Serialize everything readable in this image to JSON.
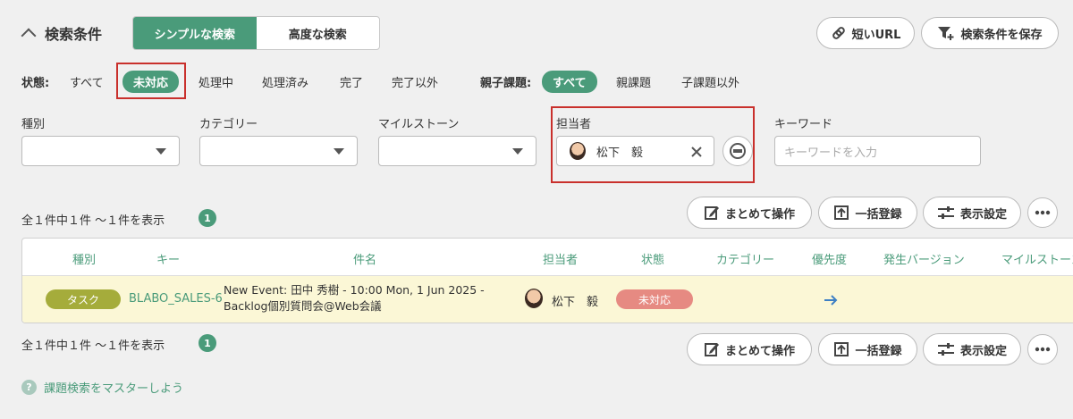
{
  "header": {
    "title": "検索条件",
    "tabs": [
      {
        "label": "シンプルな検索",
        "active": true
      },
      {
        "label": "高度な検索",
        "active": false
      }
    ],
    "short_url_label": "短いURL",
    "save_condition_label": "検索条件を保存"
  },
  "status_filter": {
    "label": "状態:",
    "options": [
      "すべて",
      "未対応",
      "処理中",
      "処理済み",
      "完了",
      "完了以外"
    ],
    "selected": "未対応"
  },
  "parent_filter": {
    "label": "親子課題:",
    "options": [
      "すべて",
      "親課題",
      "子課題以外"
    ],
    "selected": "すべて"
  },
  "fields": {
    "type_label": "種別",
    "category_label": "カテゴリー",
    "milestone_label": "マイルストーン",
    "assignee_label": "担当者",
    "assignee_value": "松下　毅",
    "keyword_label": "キーワード",
    "keyword_placeholder": "キーワードを入力"
  },
  "summary": {
    "count_text": "全１件中１件 〜１件を表示",
    "page_badge": "1"
  },
  "actions": {
    "bulk_label": "まとめて操作",
    "bulk_register_label": "一括登録",
    "display_settings_label": "表示設定"
  },
  "table": {
    "headers": [
      "種別",
      "キー",
      "件名",
      "担当者",
      "状態",
      "カテゴリー",
      "優先度",
      "発生バージョン",
      "マイルストーン"
    ],
    "rows": [
      {
        "type": "タスク",
        "key": "BLABO_SALES-6",
        "subject_line1": "New Event: 田中 秀樹 - 10:00 Mon, 1 Jun 2025 -",
        "subject_line2": "Backlog個別質問会@Web会議",
        "assignee": "松下　毅",
        "status": "未対応",
        "priority_icon": "arrow-right-icon"
      }
    ]
  },
  "help_link": "課題検索をマスターしよう",
  "colors": {
    "accent": "#4a9b7a",
    "highlight_row": "#fbf7d6",
    "status_open": "#e68a82",
    "type_task": "#a5ac3b",
    "annotation_red": "#c9302c"
  }
}
